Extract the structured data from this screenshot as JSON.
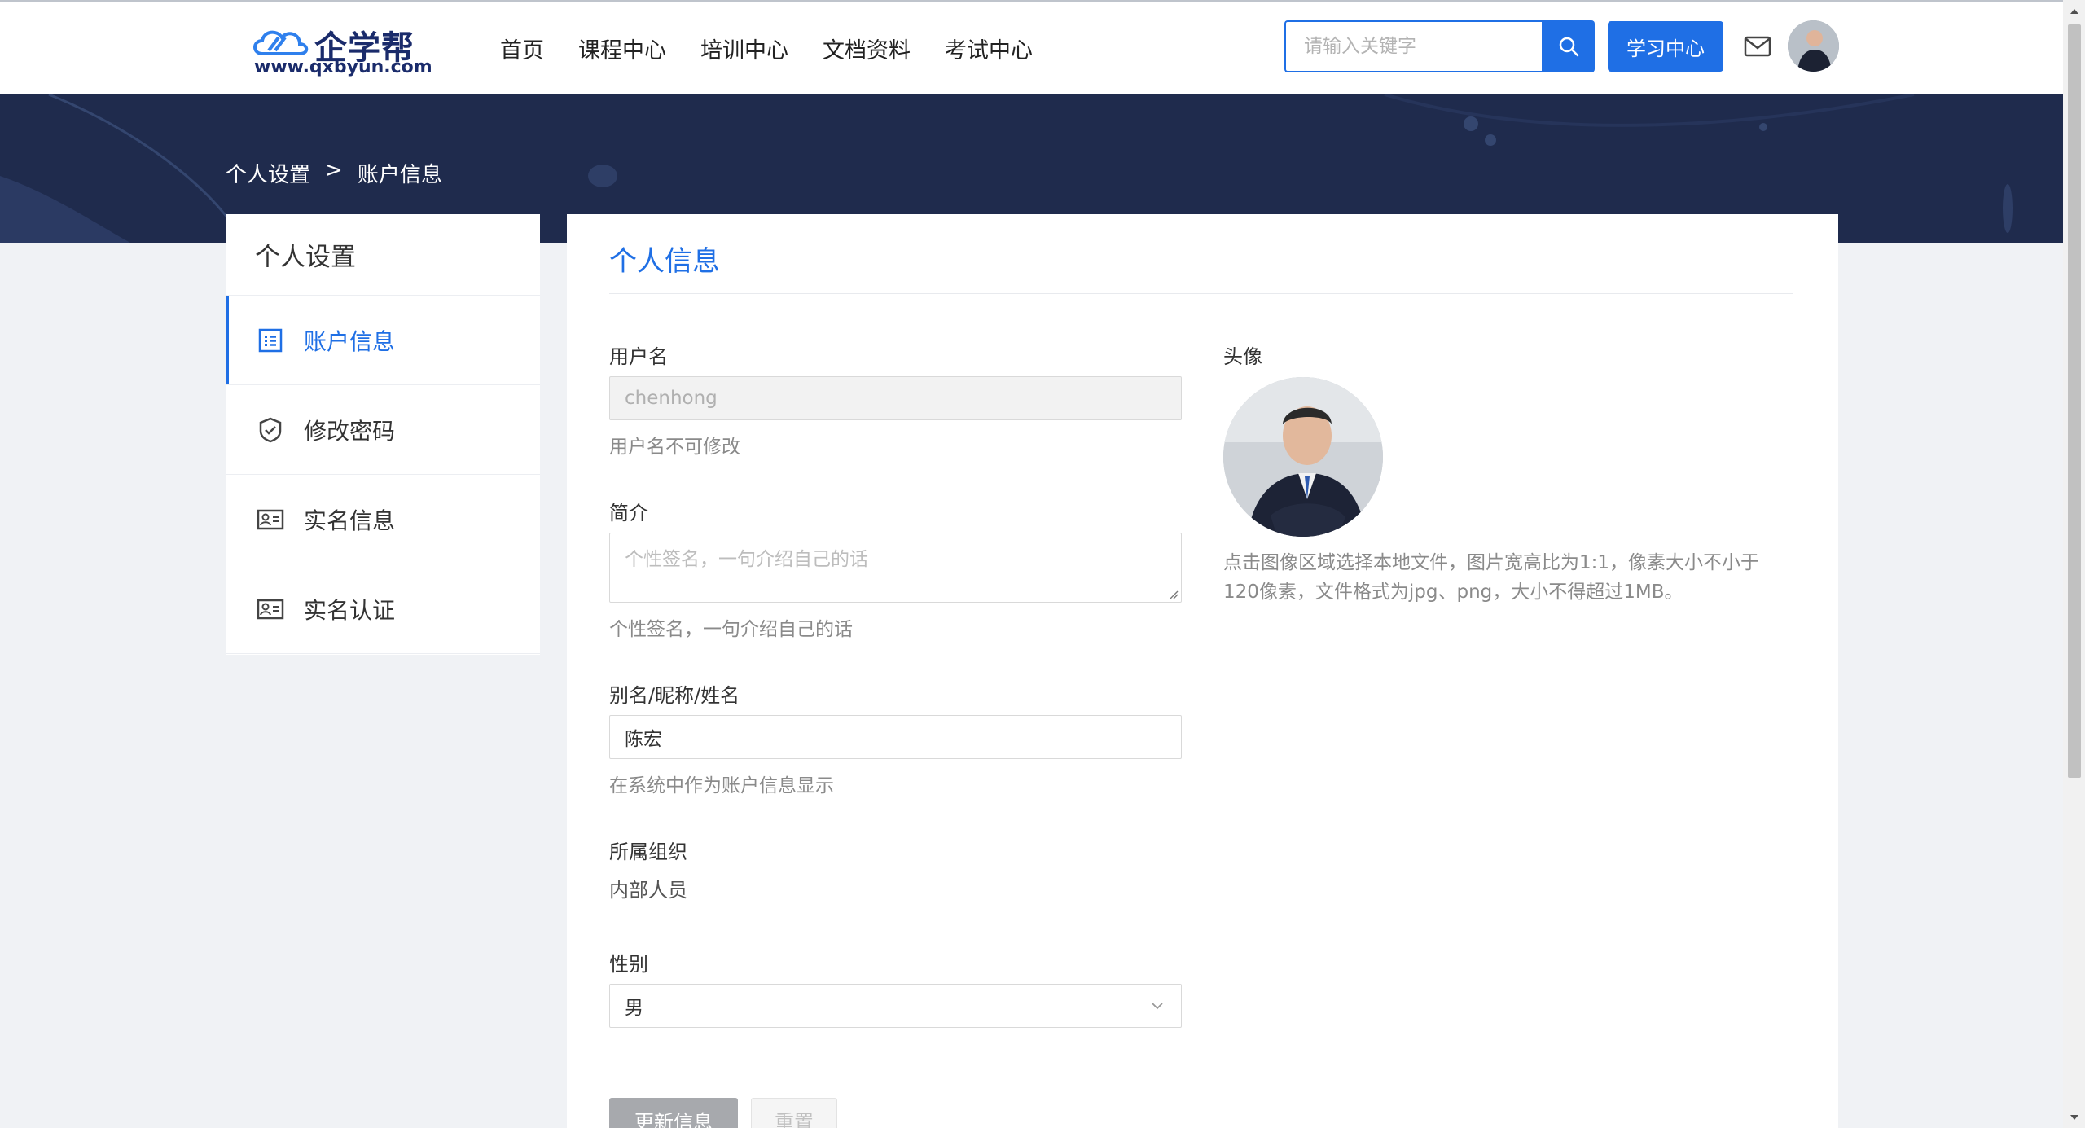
{
  "header": {
    "logo": {
      "brand": "企学帮",
      "url": "www.qxbyun.com"
    },
    "nav": [
      "首页",
      "课程中心",
      "培训中心",
      "文档资料",
      "考试中心"
    ],
    "search": {
      "placeholder": "请输入关键字",
      "value": ""
    },
    "study_center_label": "学习中心",
    "icons": {
      "search": "search-icon",
      "mail": "mail-icon",
      "avatar": "avatar"
    }
  },
  "breadcrumb": {
    "parent": "个人设置",
    "separator": ">",
    "current": "账户信息"
  },
  "sidebar": {
    "title": "个人设置",
    "items": [
      {
        "label": "账户信息",
        "icon": "list-icon",
        "active": true
      },
      {
        "label": "修改密码",
        "icon": "shield-check-icon",
        "active": false
      },
      {
        "label": "实名信息",
        "icon": "id-card-icon",
        "active": false
      },
      {
        "label": "实名认证",
        "icon": "id-card-icon",
        "active": false
      }
    ]
  },
  "main": {
    "title": "个人信息",
    "username": {
      "label": "用户名",
      "value": "chenhong",
      "help": "用户名不可修改"
    },
    "bio": {
      "label": "简介",
      "placeholder": "个性签名，一句介绍自己的话",
      "help": "个性签名，一句介绍自己的话"
    },
    "nickname": {
      "label": "别名/昵称/姓名",
      "value": "陈宏",
      "help": "在系统中作为账户信息显示"
    },
    "organization": {
      "label": "所属组织",
      "value": "内部人员"
    },
    "gender": {
      "label": "性别",
      "value": "男"
    },
    "avatar": {
      "label": "头像",
      "note": "点击图像区域选择本地文件，图片宽高比为1:1，像素大小不小于120像素，文件格式为jpg、png，大小不得超过1MB。"
    },
    "buttons": {
      "update": "更新信息",
      "reset": "重置"
    }
  },
  "colors": {
    "primary": "#1f6fe5",
    "banner": "#1f2b4d",
    "page_bg": "#f0f2f5"
  }
}
